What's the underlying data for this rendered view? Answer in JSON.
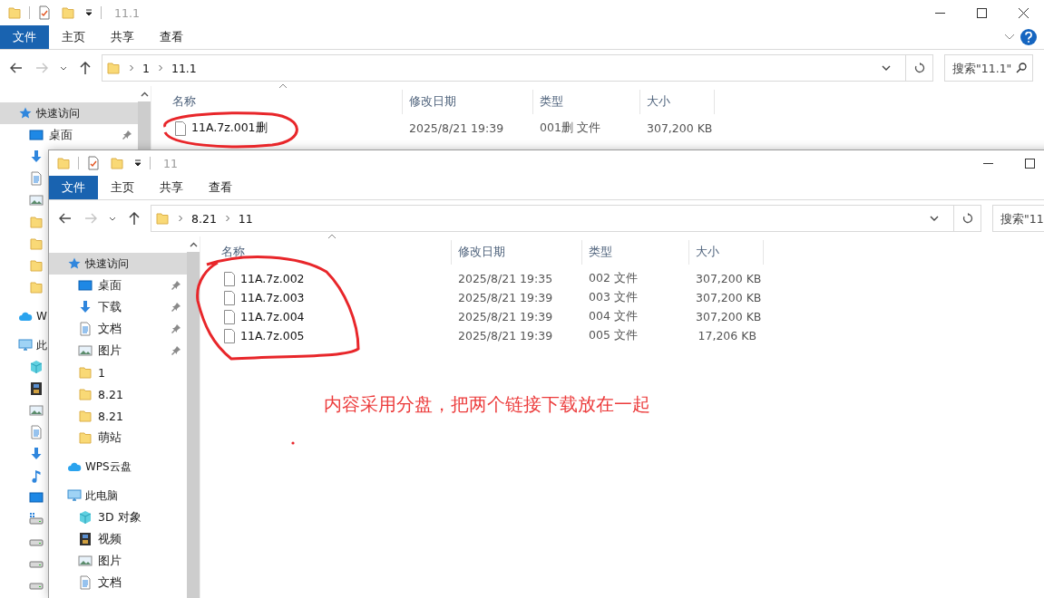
{
  "windows": [
    {
      "title": "11.1",
      "ribbon_tabs": [
        {
          "label": "文件",
          "selected": true
        },
        {
          "label": "主页",
          "selected": false
        },
        {
          "label": "共享",
          "selected": false
        },
        {
          "label": "查看",
          "selected": false
        }
      ],
      "path": [
        "1",
        "11.1"
      ],
      "search": {
        "placeholder": "搜索\"11.1\""
      },
      "nav": [
        {
          "kind": "star",
          "label": "快速访问",
          "selected": true,
          "children": [
            {
              "kind": "desktop",
              "label": "桌面",
              "pinned": true,
              "selected": false
            },
            {
              "kind": "download",
              "selected": false
            },
            {
              "kind": "document",
              "selected": false
            },
            {
              "kind": "picture",
              "selected": false
            },
            {
              "kind": "folder",
              "selected": false
            },
            {
              "kind": "folder",
              "selected": false
            },
            {
              "kind": "folder",
              "selected": false
            },
            {
              "kind": "folder",
              "selected": false
            }
          ]
        },
        {
          "kind": "cloud",
          "label": "W",
          "selected": false
        },
        {
          "kind": "pc",
          "label": "此",
          "selected": false,
          "children": [
            {
              "kind": "cube",
              "selected": false
            },
            {
              "kind": "video",
              "selected": false
            },
            {
              "kind": "picture",
              "selected": false
            },
            {
              "kind": "document",
              "selected": false
            },
            {
              "kind": "download",
              "selected": false
            },
            {
              "kind": "music",
              "selected": false
            },
            {
              "kind": "desktop",
              "selected": false
            },
            {
              "kind": "drive-win",
              "selected": false
            },
            {
              "kind": "drive",
              "selected": false
            },
            {
              "kind": "drive",
              "selected": false
            },
            {
              "kind": "drive",
              "selected": false
            }
          ]
        }
      ],
      "columns": [
        "名称",
        "修改日期",
        "类型",
        "大小"
      ],
      "files": [
        {
          "name": "11A.7z.001删",
          "modified": "2025/8/21 19:39",
          "type": "001删 文件",
          "size": "307,200 KB"
        }
      ]
    },
    {
      "title": "11",
      "ribbon_tabs": [
        {
          "label": "文件",
          "selected": true
        },
        {
          "label": "主页",
          "selected": false
        },
        {
          "label": "共享",
          "selected": false
        },
        {
          "label": "查看",
          "selected": false
        }
      ],
      "path": [
        "8.21",
        "11"
      ],
      "search": {
        "placeholder": "搜索\"11"
      },
      "nav": [
        {
          "kind": "star",
          "label": "快速访问",
          "selected": true,
          "children": [
            {
              "kind": "desktop",
              "label": "桌面",
              "pinned": true,
              "selected": false
            },
            {
              "kind": "download",
              "label": "下载",
              "pinned": true,
              "selected": false
            },
            {
              "kind": "document",
              "label": "文档",
              "pinned": true,
              "selected": false
            },
            {
              "kind": "picture",
              "label": "图片",
              "pinned": true,
              "selected": false
            },
            {
              "kind": "folder",
              "label": "1",
              "pinned": false,
              "selected": false
            },
            {
              "kind": "folder",
              "label": "8.21",
              "pinned": false,
              "selected": false
            },
            {
              "kind": "folder",
              "label": "8.21",
              "pinned": false,
              "selected": false
            },
            {
              "kind": "folder",
              "label": "萌站",
              "pinned": false,
              "selected": false
            }
          ]
        },
        {
          "kind": "cloud",
          "label": "WPS云盘",
          "selected": false
        },
        {
          "kind": "pc",
          "label": "此电脑",
          "selected": false,
          "children": [
            {
              "kind": "cube",
              "label": "3D 对象",
              "pinned": false,
              "selected": false
            },
            {
              "kind": "video",
              "label": "视频",
              "pinned": false,
              "selected": false
            },
            {
              "kind": "picture",
              "label": "图片",
              "pinned": false,
              "selected": false
            },
            {
              "kind": "document",
              "label": "文档",
              "pinned": false,
              "selected": false
            }
          ]
        }
      ],
      "columns": [
        "名称",
        "修改日期",
        "类型",
        "大小"
      ],
      "files": [
        {
          "name": "11A.7z.002",
          "modified": "2025/8/21 19:35",
          "type": "002 文件",
          "size": "307,200 KB"
        },
        {
          "name": "11A.7z.003",
          "modified": "2025/8/21 19:39",
          "type": "003 文件",
          "size": "307,200 KB"
        },
        {
          "name": "11A.7z.004",
          "modified": "2025/8/21 19:39",
          "type": "004 文件",
          "size": "307,200 KB"
        },
        {
          "name": "11A.7z.005",
          "modified": "2025/8/21 19:39",
          "type": "005 文件",
          "size": "17,206 KB"
        }
      ]
    }
  ],
  "annotation": "内容采用分盘，把两个链接下载放在一起"
}
